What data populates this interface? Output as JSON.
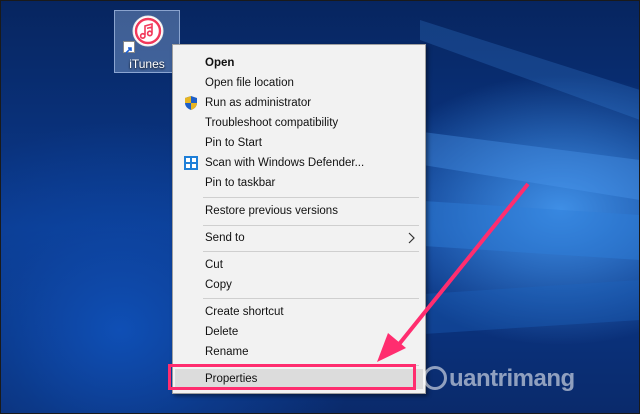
{
  "desktop": {
    "icon_label": "iTunes",
    "icon_name": "itunes-icon"
  },
  "context_menu": {
    "items": [
      {
        "label": "Open",
        "bold": true
      },
      {
        "label": "Open file location"
      },
      {
        "label": "Run as administrator",
        "icon": "uac-shield-icon"
      },
      {
        "label": "Troubleshoot compatibility"
      },
      {
        "label": "Pin to Start"
      },
      {
        "label": "Scan with Windows Defender...",
        "icon": "windows-defender-icon"
      },
      {
        "label": "Pin to taskbar"
      },
      {
        "label": "Restore previous versions"
      },
      {
        "label": "Send to",
        "submenu": true,
        "icon": "chevron-right-icon"
      },
      {
        "label": "Cut"
      },
      {
        "label": "Copy"
      },
      {
        "label": "Create shortcut"
      },
      {
        "label": "Delete"
      },
      {
        "label": "Rename"
      },
      {
        "label": "Properties",
        "highlighted": true
      }
    ]
  },
  "annotation": {
    "highlight_color": "#ff2d6f",
    "arrow_color": "#ff2d6f"
  },
  "watermark": {
    "text": "uantrimang"
  }
}
